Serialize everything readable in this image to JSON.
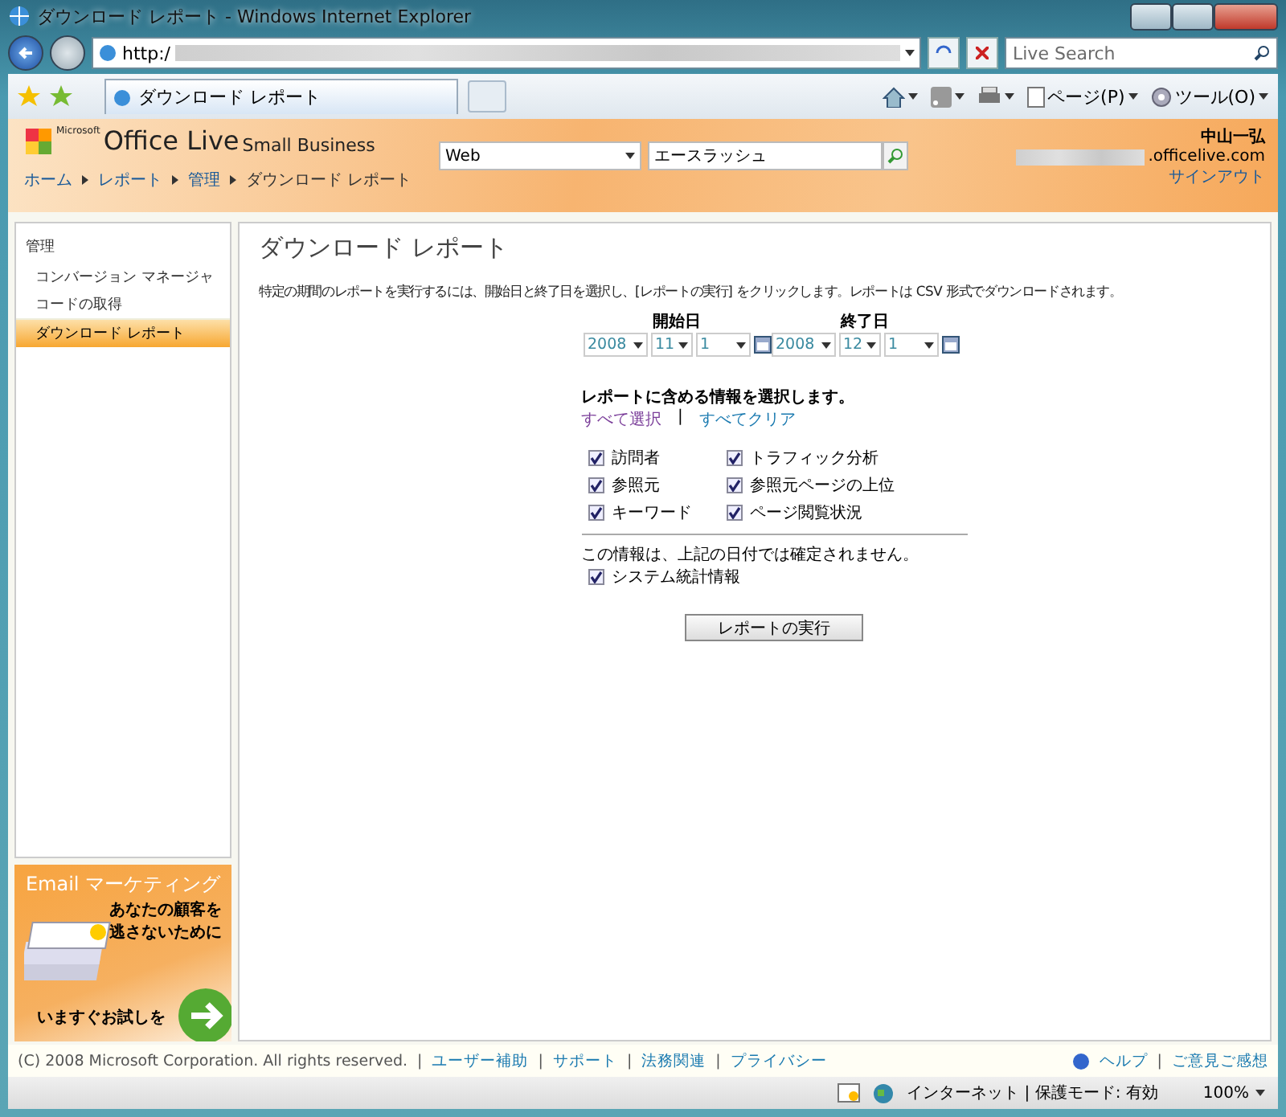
{
  "window": {
    "title": "ダウンロード レポート - Windows Internet Explorer"
  },
  "address": {
    "url": "http:/"
  },
  "search": {
    "placeholder": "Live Search"
  },
  "tab": {
    "label": "ダウンロード レポート"
  },
  "commands": [
    {
      "kind": "home"
    },
    {
      "kind": "feed"
    },
    {
      "kind": "print"
    },
    {
      "kind": "page",
      "label": "ページ(P)"
    },
    {
      "kind": "tools",
      "label": "ツール(O)"
    }
  ],
  "header": {
    "logo": {
      "maker": "Microsoft",
      "product": "Office Live",
      "edition": "Small Business"
    },
    "search_scope": "Web",
    "search_value": "エースラッシュ",
    "user": {
      "name": "中山一弘",
      "email": ".officelive.com",
      "sign_out": "サインアウト"
    },
    "breadcrumb": [
      {
        "label": "ホーム",
        "link": true
      },
      {
        "label": "レポート",
        "link": true
      },
      {
        "label": "管理",
        "link": true
      },
      {
        "label": "ダウンロード レポート",
        "link": false
      }
    ]
  },
  "sidebar": {
    "heading": "管理",
    "items": [
      {
        "label": "コンバージョン マネージャ",
        "selected": false
      },
      {
        "label": "コードの取得",
        "selected": false
      },
      {
        "label": "ダウンロード レポート",
        "selected": true
      }
    ]
  },
  "ad": {
    "title": "Email マーケティング",
    "lines": [
      "あなたの顧客を",
      "逃さないために"
    ],
    "cta": "いますぐお試しを"
  },
  "main": {
    "title": "ダウンロード レポート",
    "instructions": "特定の期間のレポートを実行するには、開始日と終了日を選択し、[レポートの実行] をクリックします。レポートは CSV 形式でダウンロードされます。",
    "start": {
      "label": "開始日",
      "year": "2008",
      "month": "11",
      "day": "1"
    },
    "end": {
      "label": "終了日",
      "year": "2008",
      "month": "12",
      "day": "1"
    },
    "section": "レポートに含める情報を選択します。",
    "select_all": "すべて選択",
    "separator": "|",
    "clear_all": "すべてクリア",
    "options": [
      {
        "label": "訪問者",
        "checked": true
      },
      {
        "label": "トラフィック分析",
        "checked": true
      },
      {
        "label": "参照元",
        "checked": true
      },
      {
        "label": "参照元ページの上位",
        "checked": true
      },
      {
        "label": "キーワード",
        "checked": true
      },
      {
        "label": "ページ閲覧状況",
        "checked": true
      }
    ],
    "note": "この情報は、上記の日付では確定されません。",
    "extra": [
      {
        "label": "システム統計情報",
        "checked": true
      }
    ],
    "run_button": "レポートの実行"
  },
  "footer": {
    "copyright": "(C) 2008 Microsoft Corporation. All rights reserved.",
    "links": [
      "ユーザー補助",
      "サポート",
      "法務関連",
      "プライバシー"
    ],
    "separator": "|",
    "help": "ヘルプ",
    "feedback": "ご意見ご感想"
  },
  "status": {
    "zone": "インターネット | 保護モード: 有効",
    "zoom": "100%"
  }
}
